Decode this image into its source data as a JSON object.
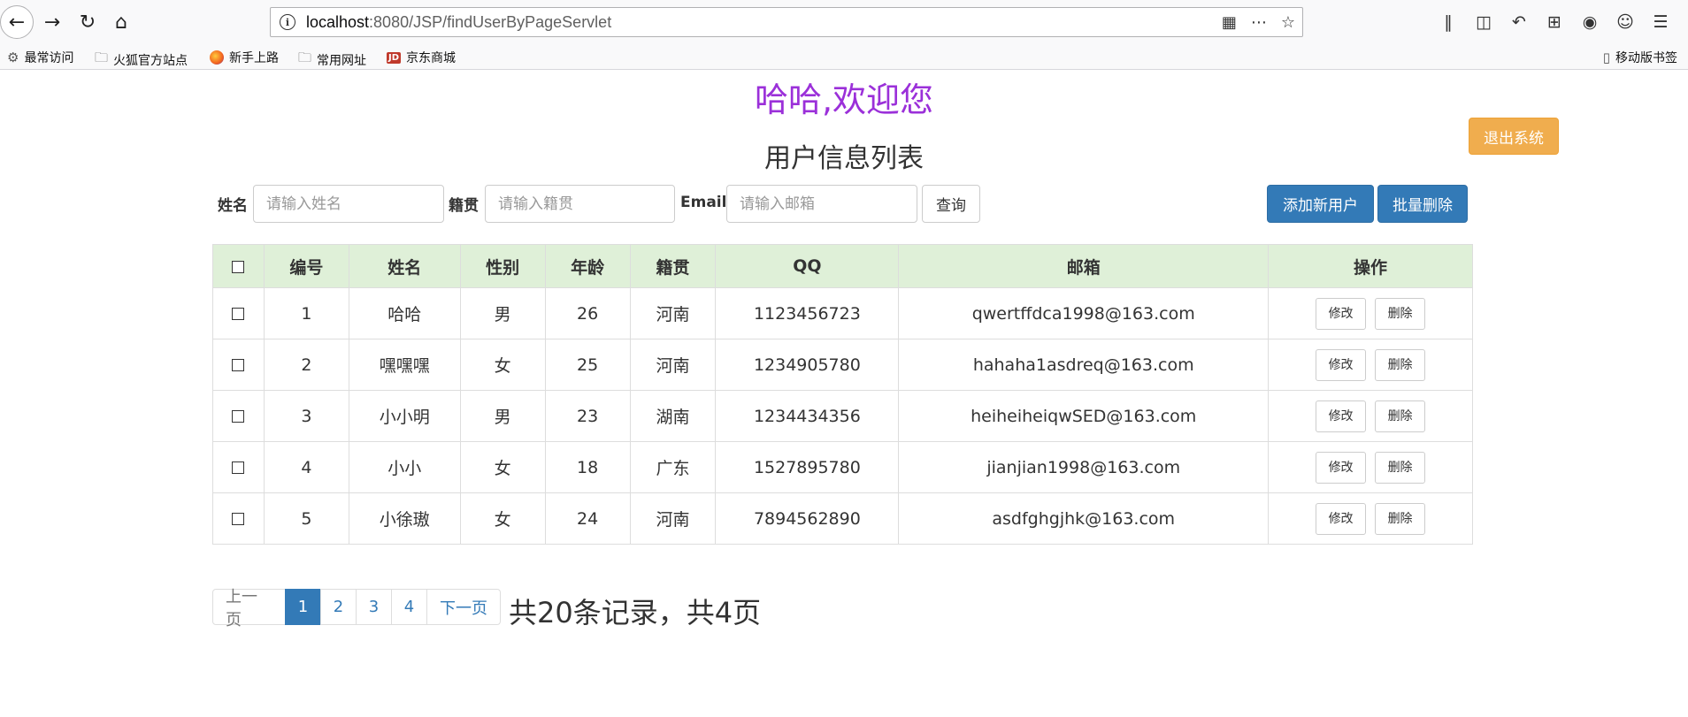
{
  "browser": {
    "url_host": "localhost",
    "url_rest": ":8080/JSP/findUserByPageServlet",
    "bookmarks": [
      "最常访问",
      "火狐官方站点",
      "新手上路",
      "常用网址",
      "京东商城"
    ],
    "mobile_bookmarks": "移动版书签",
    "icons": [
      "back-icon",
      "forward-icon",
      "reload-icon",
      "home-icon",
      "info-icon",
      "qr-icon",
      "more-icon",
      "star-icon",
      "library-icon",
      "sidebar-icon",
      "undo-icon",
      "crop-icon",
      "chat-icon",
      "account-icon",
      "menu-icon"
    ]
  },
  "page": {
    "welcome": "哈哈,欢迎您",
    "logout_label": "退出系统",
    "title": "用户信息列表"
  },
  "search": {
    "name_label": "姓名",
    "name_placeholder": "请输入姓名",
    "origin_label": "籍贯",
    "origin_placeholder": "请输入籍贯",
    "email_label": "Email",
    "email_placeholder": "请输入邮箱",
    "query_label": "查询",
    "add_label": "添加新用户",
    "batch_delete_label": "批量删除"
  },
  "table": {
    "headers": [
      "编号",
      "姓名",
      "性别",
      "年龄",
      "籍贯",
      "QQ",
      "邮箱",
      "操作"
    ],
    "edit_label": "修改",
    "delete_label": "删除",
    "rows": [
      {
        "id": "1",
        "name": "哈哈",
        "gender": "男",
        "age": "26",
        "origin": "河南",
        "qq": "1123456723",
        "email": "qwertffdca1998@163.com"
      },
      {
        "id": "2",
        "name": "嘿嘿嘿",
        "gender": "女",
        "age": "25",
        "origin": "河南",
        "qq": "1234905780",
        "email": "hahaha1asdreq@163.com"
      },
      {
        "id": "3",
        "name": "小小明",
        "gender": "男",
        "age": "23",
        "origin": "湖南",
        "qq": "1234434356",
        "email": "heiheiheiqwSED@163.com"
      },
      {
        "id": "4",
        "name": "小小",
        "gender": "女",
        "age": "18",
        "origin": "广东",
        "qq": "1527895780",
        "email": "jianjian1998@163.com"
      },
      {
        "id": "5",
        "name": "小徐璈",
        "gender": "女",
        "age": "24",
        "origin": "河南",
        "qq": "7894562890",
        "email": "asdfghgjhk@163.com"
      }
    ]
  },
  "pagination": {
    "prev": "上一页",
    "pages": [
      "1",
      "2",
      "3",
      "4"
    ],
    "active": "1",
    "next": "下一页",
    "summary": "共20条记录，共4页"
  },
  "colors": {
    "welcome": "#9b30d9",
    "primary": "#337ab7",
    "warning": "#f0ad4e",
    "table_header": "#dff0d8"
  }
}
